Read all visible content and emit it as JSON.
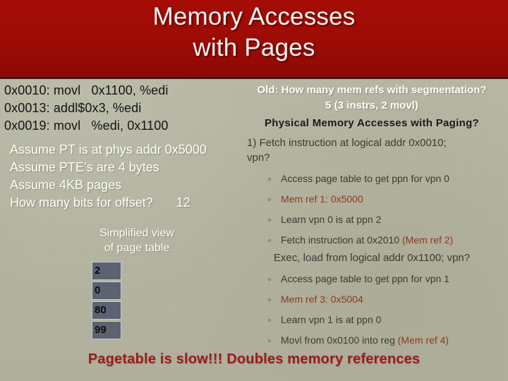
{
  "slide": {
    "title": "Memory Accesses\nwith Pages",
    "background_color": "#b5b5a2",
    "title_band_color": "#9d0b05",
    "footer": "Pagetable is slow!!! Doubles memory references",
    "footer_color": "#9c1c1c"
  },
  "code": {
    "lines": [
      "0x0010: movl   0x1100, %edi",
      "0x0013: addl$0x3, %edi",
      "0x0019: movl   %edi, 0x1100"
    ]
  },
  "assumptions": {
    "lines": [
      "Assume PT is at phys addr 0x5000",
      "Assume PTE’s are 4 bytes",
      "Assume 4KB pages"
    ],
    "question": "How many bits for offset?",
    "answer": "12"
  },
  "page_table": {
    "caption": "Simplified view\nof page table",
    "cells": [
      "2",
      "0",
      "80",
      "99"
    ],
    "cell_color": "#5c6271"
  },
  "right": {
    "old_question": "Old: How many mem refs with segmentation?",
    "old_answer": "5 (3 instrs, 2 movl)",
    "heading": "Physical Memory Accesses with Paging?",
    "step1": "1) Fetch instruction at logical addr 0x0010;\n     vpn?",
    "step1_bullets": [
      {
        "text": "Access page table to get ppn for vpn 0",
        "red": false
      },
      {
        "text": "Mem ref 1: 0x5000",
        "red": true
      },
      {
        "text": "Learn vpn 0 is at ppn 2",
        "red": false
      },
      {
        "text": "Fetch instruction at  0x2010 ",
        "tail": "(Mem ref 2)",
        "red": false
      }
    ],
    "step2": "Exec, load from logical addr 0x1100; vpn?",
    "step2_bullets": [
      {
        "text": "Access page table to get ppn for vpn 1",
        "red": false
      },
      {
        "text": "Mem ref 3: 0x5004",
        "red": true
      },
      {
        "text": "Learn vpn 1 is at ppn 0",
        "red": false
      },
      {
        "text": "Movl from 0x0100 into reg ",
        "tail": "(Mem ref 4)",
        "red": false
      }
    ],
    "accent_red": "#8c3a23"
  }
}
